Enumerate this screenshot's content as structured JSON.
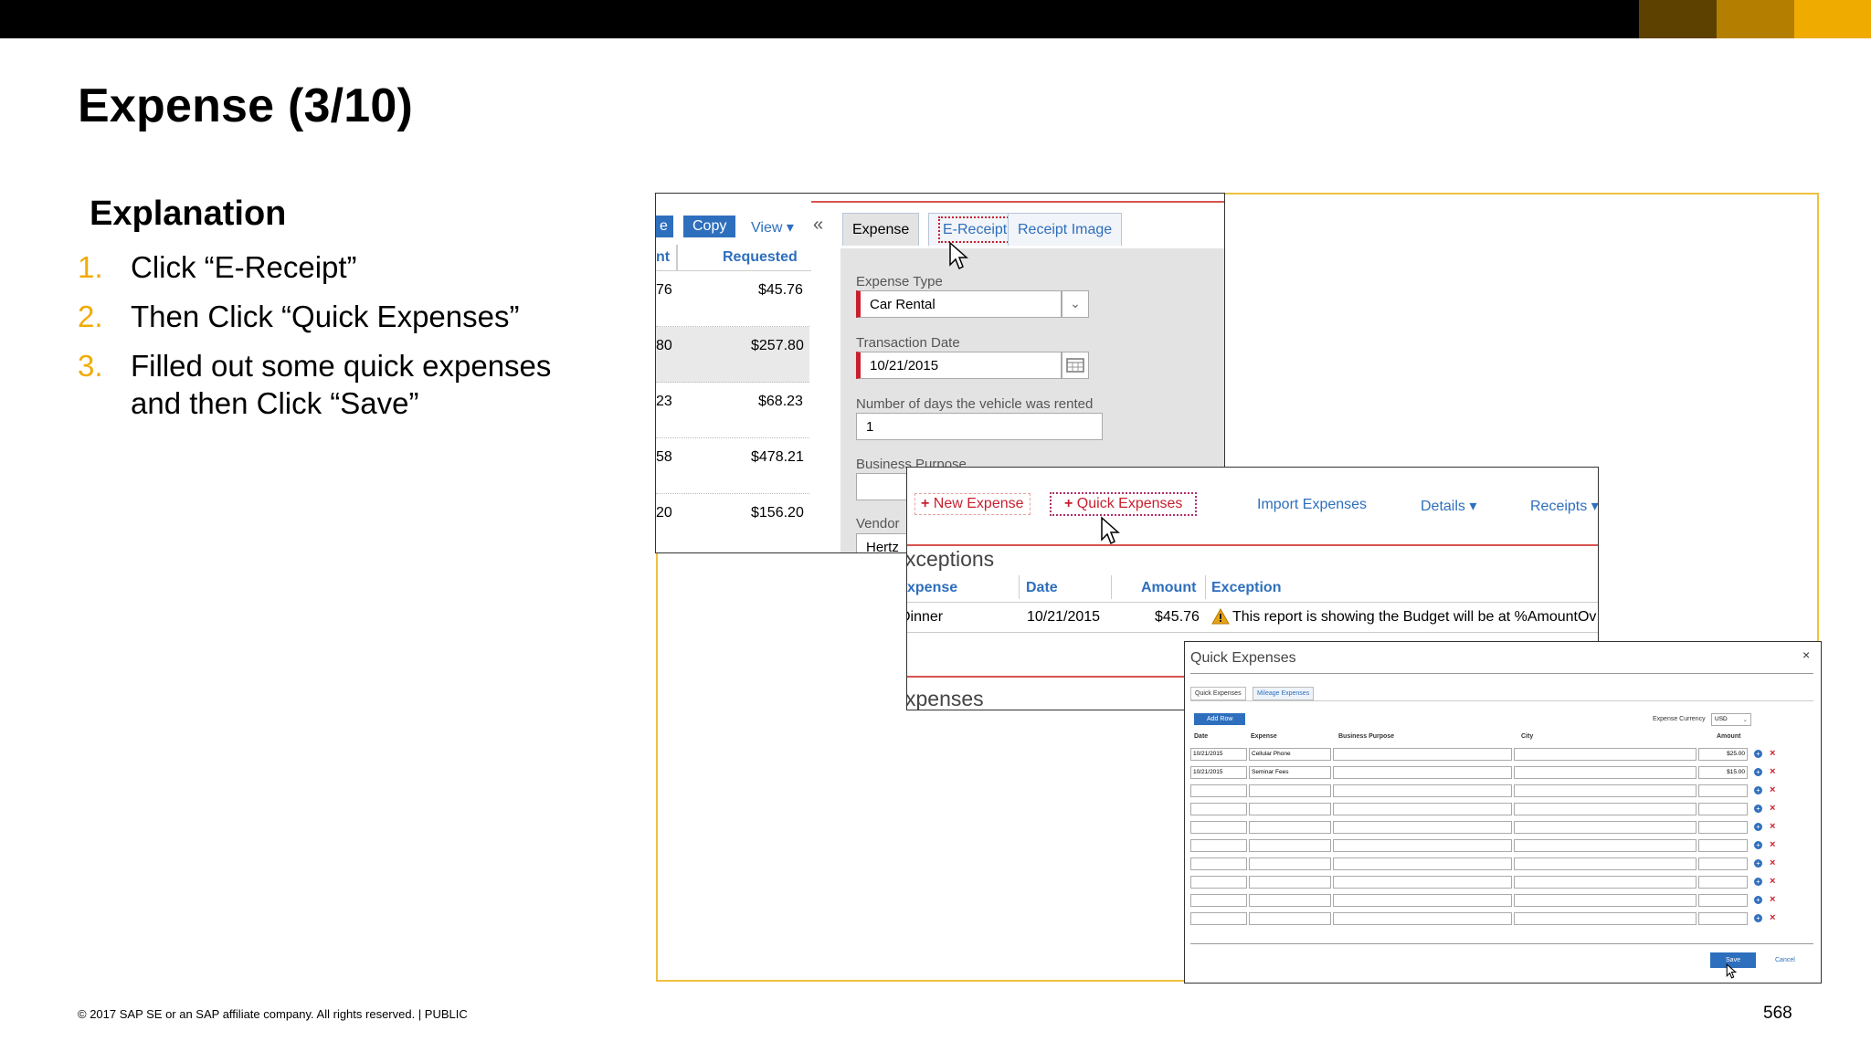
{
  "slide": {
    "title": "Expense (3/10)",
    "explanation_heading": "Explanation",
    "steps": [
      {
        "num": "1.",
        "text": "Click “E-Receipt”"
      },
      {
        "num": "2.",
        "text": "Then Click “Quick Expenses”"
      },
      {
        "num": "3.",
        "text": "Filled out some quick expenses",
        "text2": "and then Click “Save”"
      }
    ],
    "footer": "© 2017 SAP SE or an SAP affiliate company. All rights reserved.   |   PUBLIC",
    "page_number": "568",
    "colors": {
      "accent": "#f0ab00",
      "band1": "#5c4100",
      "band2": "#b47f00",
      "band3": "#f0ab00",
      "ui_blue": "#2e6fbd",
      "required_red": "#c91f2e"
    }
  },
  "shot1": {
    "toolbar": {
      "partial_btn": "e",
      "copy": "Copy",
      "view": "View ▾",
      "collapse": "«"
    },
    "list_headers": {
      "partial": "nt",
      "requested": "Requested"
    },
    "rows": [
      {
        "partial": "76",
        "requested": "$45.76"
      },
      {
        "partial": "80",
        "requested": "$257.80"
      },
      {
        "partial": "23",
        "requested": "$68.23"
      },
      {
        "partial": "58",
        "requested": "$478.21"
      },
      {
        "partial": "20",
        "requested": "$156.20"
      }
    ],
    "tabs": {
      "expense": "Expense",
      "ereceipt": "E-Receipt",
      "receipt_image": "Receipt Image"
    },
    "form": {
      "expense_type_label": "Expense Type",
      "expense_type_value": "Car Rental",
      "transaction_date_label": "Transaction Date",
      "transaction_date_value": "10/21/2015",
      "days_label": "Number of days the vehicle was rented",
      "days_value": "1",
      "business_purpose_label": "Business Purpose",
      "vendor_label": "Vendor",
      "vendor_value": "Hertz"
    }
  },
  "shot2": {
    "toolbar": {
      "new_expense": "New Expense",
      "quick_expenses": "Quick Expenses",
      "import_expenses": "Import Expenses",
      "details": "Details ▾",
      "receipts": "Receipts ▾"
    },
    "exceptions_title": "xceptions",
    "headers": {
      "expense": "xpense",
      "date": "Date",
      "amount": "Amount",
      "exception": "Exception"
    },
    "row": {
      "expense": "Dinner",
      "date": "10/21/2015",
      "amount": "$45.76",
      "exception": "This report is showing the Budget will be at %AmountOv"
    },
    "expenses_title": "xpenses"
  },
  "shot3": {
    "title": "Quick Expenses",
    "close": "×",
    "tabs": {
      "quick": "Quick Expenses",
      "mileage": "Mileage Expenses"
    },
    "add_row": "Add Row",
    "currency_label": "Expense Currency",
    "currency_value": "USD",
    "headers": {
      "date": "Date",
      "expense": "Expense",
      "business_purpose": "Business Purpose",
      "city": "City",
      "amount": "Amount"
    },
    "rows": [
      {
        "date": "10/21/2015",
        "expense": "Cellular Phone",
        "amount": "$25.00"
      },
      {
        "date": "10/21/2015",
        "expense": "Seminar Fees",
        "amount": "$15.00"
      },
      {
        "date": "",
        "expense": "",
        "amount": ""
      },
      {
        "date": "",
        "expense": "",
        "amount": ""
      },
      {
        "date": "",
        "expense": "",
        "amount": ""
      },
      {
        "date": "",
        "expense": "",
        "amount": ""
      },
      {
        "date": "",
        "expense": "",
        "amount": ""
      },
      {
        "date": "",
        "expense": "",
        "amount": ""
      },
      {
        "date": "",
        "expense": "",
        "amount": ""
      },
      {
        "date": "",
        "expense": "",
        "amount": ""
      }
    ],
    "save": "Save",
    "cancel": "Cancel"
  }
}
